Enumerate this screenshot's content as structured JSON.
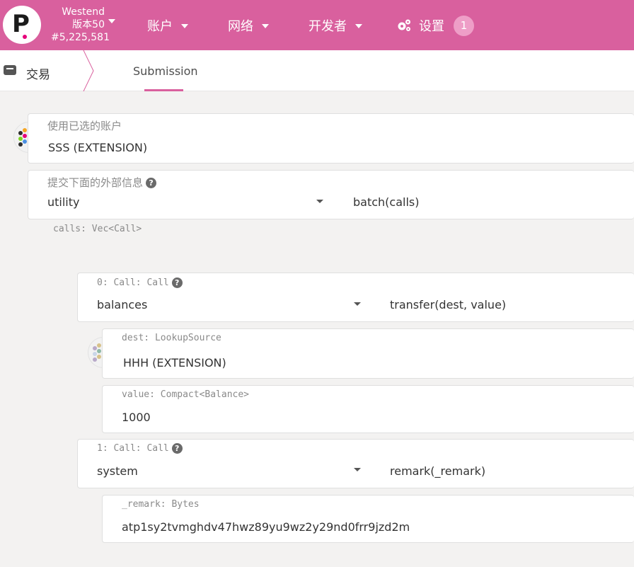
{
  "header": {
    "chain_name": "Westend",
    "chain_version": "版本50",
    "block_number": "#5,225,581",
    "menu": [
      {
        "label": "账户"
      },
      {
        "label": "网络"
      },
      {
        "label": "开发者"
      },
      {
        "label": "设置"
      }
    ],
    "notification_count": "1"
  },
  "tabs": {
    "section_label": "交易",
    "active_tab": "Submission"
  },
  "form": {
    "account_label": "使用已选的账户",
    "account_value": "SSS (EXTENSION)",
    "extrinsic_label": "提交下面的外部信息",
    "extrinsic_module": "utility",
    "extrinsic_method": "batch(calls)",
    "calls_label": "calls: Vec<Call>",
    "calls": [
      {
        "label": "0: Call: Call",
        "module": "balances",
        "method": "transfer(dest, value)",
        "params": [
          {
            "label": "dest: LookupSource",
            "value": "HHH (EXTENSION)"
          },
          {
            "label": "value: Compact<Balance>",
            "value": "1000"
          }
        ]
      },
      {
        "label": "1: Call: Call",
        "module": "system",
        "method": "remark(_remark)",
        "params": [
          {
            "label": "_remark: Bytes",
            "value": "atp1sy2tvmghdv47hwz89yu9wz2y29nd0frr9jzd2m"
          }
        ]
      }
    ]
  },
  "icons": {
    "logo": "polkadot-logo",
    "settings": "gear-icon",
    "help": "question-circle-icon",
    "transaction": "envelope-icon"
  },
  "colors": {
    "brand": "#d9609e",
    "badge": "#ee9ec7"
  }
}
